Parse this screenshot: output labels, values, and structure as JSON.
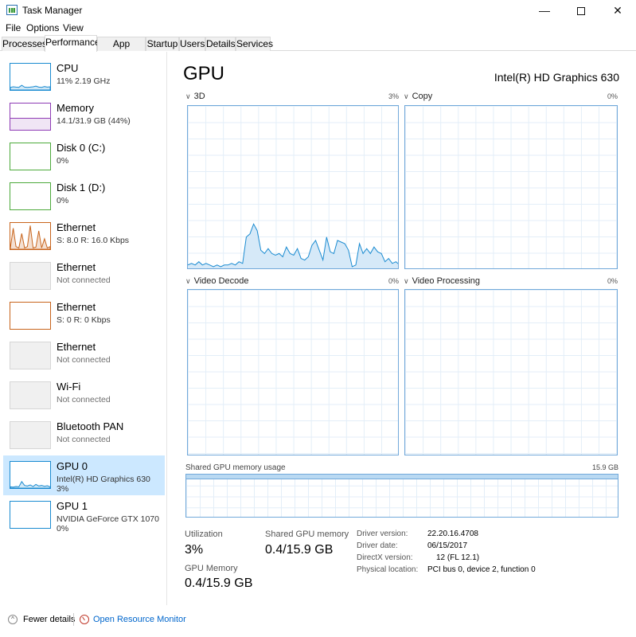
{
  "window": {
    "title": "Task Manager",
    "controls": {
      "minimize": "—",
      "close": "✕"
    }
  },
  "menu": [
    "File",
    "Options",
    "View"
  ],
  "tabs": [
    "Processes",
    "Performance",
    "App history",
    "Startup",
    "Users",
    "Details",
    "Services"
  ],
  "active_tab": "Performance",
  "sidebar": [
    {
      "name": "CPU",
      "sub": "11%  2.19 GHz",
      "color": "#1a8bd1",
      "sparkline": [
        10,
        12,
        11,
        10,
        18,
        11,
        10,
        11,
        12,
        15,
        11,
        10,
        13,
        11,
        12
      ]
    },
    {
      "name": "Memory",
      "sub": "14.1/31.9 GB (44%)",
      "color": "#8e3bb5",
      "level": 0.44
    },
    {
      "name": "Disk 0 (C:)",
      "sub": "0%",
      "color": "#4caa3b"
    },
    {
      "name": "Disk 1 (D:)",
      "sub": "0%",
      "color": "#4caa3b"
    },
    {
      "name": "Ethernet",
      "sub": "S: 8.0  R: 16.0 Kbps",
      "color": "#c8641c",
      "sparkline": [
        5,
        80,
        10,
        5,
        60,
        5,
        10,
        90,
        5,
        8,
        70,
        5,
        40,
        5,
        10
      ]
    },
    {
      "name": "Ethernet",
      "sub": "Not connected",
      "color": "#d6d6d6",
      "grey": true
    },
    {
      "name": "Ethernet",
      "sub": "S: 0  R: 0 Kbps",
      "color": "#c8641c"
    },
    {
      "name": "Ethernet",
      "sub": "Not connected",
      "color": "#d6d6d6",
      "grey": true
    },
    {
      "name": "Wi-Fi",
      "sub": "Not connected",
      "color": "#d6d6d6",
      "grey": true
    },
    {
      "name": "Bluetooth PAN",
      "sub": "Not connected",
      "color": "#d6d6d6",
      "grey": true
    },
    {
      "name": "GPU 0",
      "sub": "Intel(R) HD Graphics 630",
      "sub2": "3%",
      "color": "#1a8bd1",
      "selected": true,
      "sparkline": [
        5,
        4,
        6,
        5,
        25,
        10,
        8,
        12,
        6,
        14,
        8,
        10,
        7,
        9,
        5
      ]
    },
    {
      "name": "GPU 1",
      "sub": "NVIDIA GeForce GTX 1070",
      "sub2": "0%",
      "color": "#1a8bd1"
    }
  ],
  "gpu": {
    "title": "GPU",
    "model": "Intel(R) HD Graphics 630",
    "engines": [
      {
        "name": "3D",
        "percent": "3%",
        "chevron": "∨",
        "samples": [
          3,
          4,
          3,
          5,
          3,
          4,
          3,
          2,
          3,
          2,
          3,
          3,
          4,
          3,
          5,
          4,
          20,
          22,
          28,
          24,
          12,
          10,
          13,
          10,
          9,
          10,
          8,
          14,
          10,
          9,
          13,
          7,
          6,
          8,
          15,
          18,
          12,
          6,
          20,
          11,
          10,
          18,
          17,
          16,
          12,
          2,
          3,
          16,
          10,
          13,
          10,
          14,
          11,
          10,
          5,
          7,
          4,
          5,
          3
        ]
      },
      {
        "name": "Copy",
        "percent": "0%",
        "chevron": "∨",
        "samples": []
      },
      {
        "name": "Video Decode",
        "percent": "0%",
        "chevron": "∨",
        "samples": []
      },
      {
        "name": "Video Processing",
        "percent": "0%",
        "chevron": "∨",
        "samples": []
      }
    ],
    "shared_memory": {
      "label": "Shared GPU memory usage",
      "max": "15.9 GB",
      "level": 0.025
    },
    "stats": {
      "utilization_label": "Utilization",
      "utilization_value": "3%",
      "shared_label": "Shared GPU memory",
      "shared_value": "0.4/15.9 GB",
      "gpu_mem_label": "GPU Memory",
      "gpu_mem_value": "0.4/15.9 GB"
    },
    "info": [
      {
        "label": "Driver version:",
        "value": "22.20.16.4708"
      },
      {
        "label": "Driver date:",
        "value": "06/15/2017"
      },
      {
        "label": "DirectX version:",
        "value": "12 (FL 12.1)"
      },
      {
        "label": "Physical location:",
        "value": "PCI bus 0, device 2, function 0"
      }
    ]
  },
  "footer": {
    "fewer_details": "Fewer details",
    "open_resource_monitor": "Open Resource Monitor"
  }
}
